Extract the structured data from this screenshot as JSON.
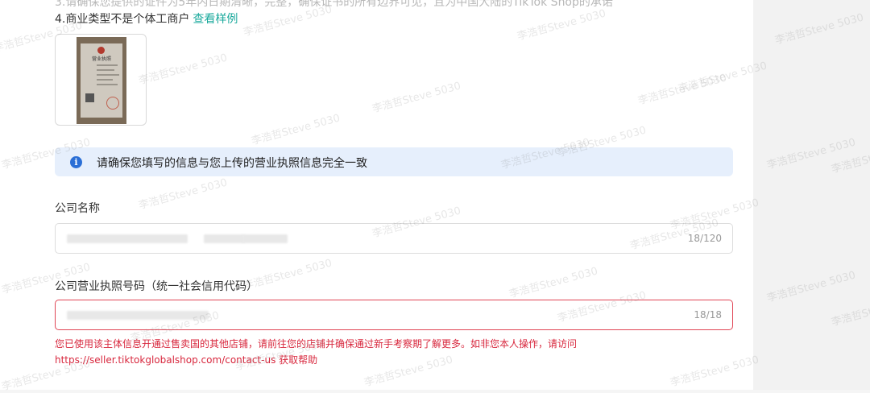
{
  "requirements": {
    "partial_line": "3.请确保您提供的证件为5年内日期清晰，完整，确保证书的所有边界可见，且为中国大陆的TikTok Shop的承诺",
    "item4_text": "4.商业类型不是个体工商户",
    "item4_link": "查看样例"
  },
  "sample_image": {
    "cert_title": "营业执照"
  },
  "alert": {
    "icon": "info-icon",
    "text": "请确保您填写的信息与您上传的营业执照信息完全一致"
  },
  "company_name": {
    "label": "公司名称",
    "counter": "18/120"
  },
  "license_number": {
    "label": "公司营业执照号码（统一社会信用代码）",
    "counter": "18/18",
    "error": "您已使用该主体信息开通过售卖国的其他店铺，请前往您的店铺并确保通过新手考察期了解更多。如非您本人操作，请访问 https://seller.tiktokglobalshop.com/contact-us 获取帮助"
  },
  "watermark": "李浩哲Steve 5030",
  "colors": {
    "link": "#1aa99c",
    "alert_bg": "#e6effc",
    "info_icon": "#2b6fd6",
    "error": "#d8283e"
  }
}
